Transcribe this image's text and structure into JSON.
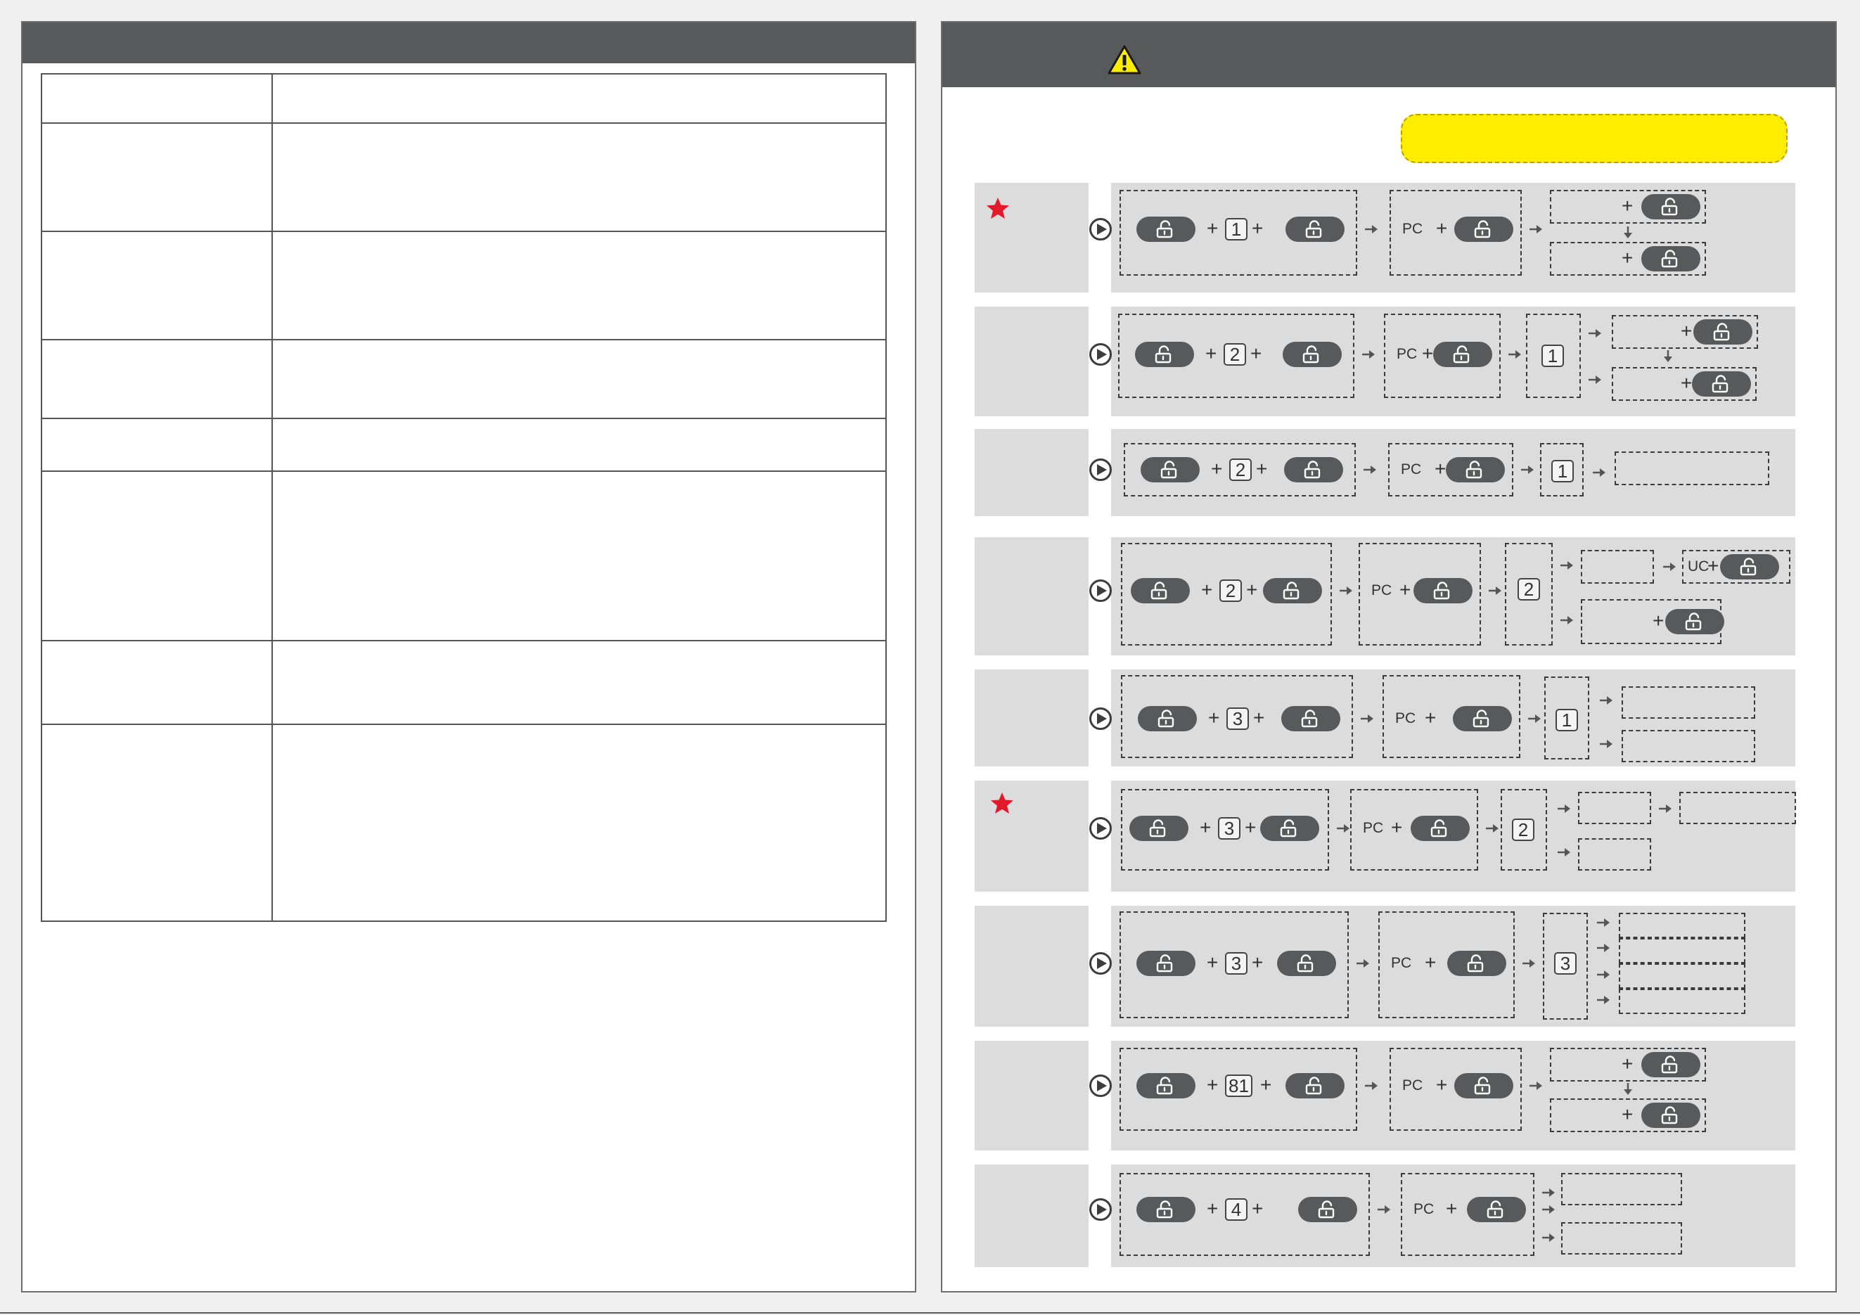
{
  "tokens": {
    "plus": "+",
    "pc": "PC",
    "uc": "UC"
  },
  "colors": {
    "header_bar": "#58595b",
    "row_background": "#dcdcdd",
    "note_highlight": "#ffed00",
    "star": "#e3192b",
    "warning_icon": "#ffed00",
    "key_pill": "#58595b"
  },
  "icons": {
    "warning": "warning-triangle-icon",
    "key": "unlock-key-icon",
    "play": "play-circle-icon",
    "star": "star-icon",
    "arrow": "arrow-right-icon"
  },
  "rows": [
    {
      "starred": true,
      "code": "1"
    },
    {
      "starred": false,
      "code": "2",
      "step": "1"
    },
    {
      "starred": false,
      "code": "2",
      "step": "1"
    },
    {
      "starred": false,
      "code": "2",
      "step": "2"
    },
    {
      "starred": false,
      "code": "3",
      "step": "1"
    },
    {
      "starred": true,
      "code": "3",
      "step": "2"
    },
    {
      "starred": false,
      "code": "3",
      "step": "3"
    },
    {
      "starred": false,
      "code": "81"
    },
    {
      "starred": false,
      "code": "4"
    }
  ]
}
